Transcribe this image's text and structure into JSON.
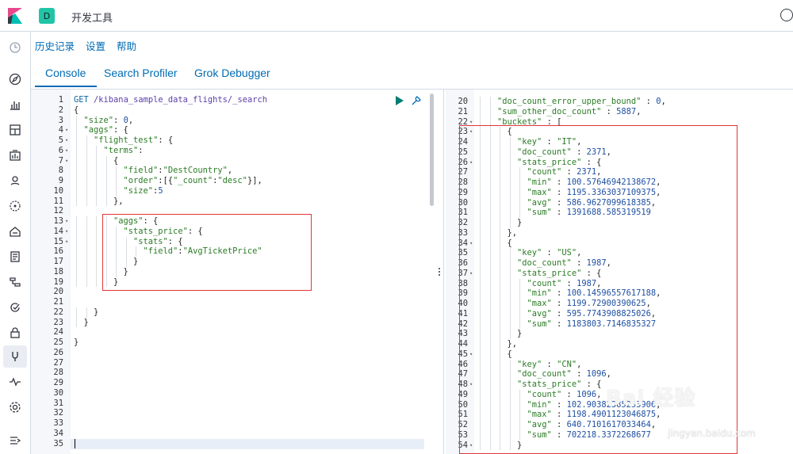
{
  "header": {
    "space_initial": "D",
    "app_title": "开发工具"
  },
  "menu": {
    "history": "历史记录",
    "settings": "设置",
    "help": "帮助"
  },
  "tabs": [
    {
      "label": "Console",
      "active": true
    },
    {
      "label": "Search Profiler",
      "active": false
    },
    {
      "label": "Grok Debugger",
      "active": false
    }
  ],
  "colors": {
    "accent": "#006bb4",
    "space_badge": "#1fc5a6",
    "highlight_box": "#e0353b",
    "run_button": "#017d73"
  },
  "sidebar_icons": [
    "clock-icon",
    "compass-icon",
    "bar-chart-icon",
    "dashboard-icon",
    "canvas-icon",
    "maps-icon",
    "ml-icon",
    "infrastructure-icon",
    "logs-icon",
    "apm-icon",
    "uptime-icon",
    "security-icon",
    "dev-tools-icon",
    "monitoring-icon",
    "management-icon",
    "collapse-icon"
  ],
  "request_editor": {
    "lines": [
      {
        "n": "1",
        "fold": false,
        "indent": 0,
        "tokens": [
          [
            "k",
            "GET "
          ],
          [
            "u",
            "/kibana_sample_data_flights/_search"
          ]
        ]
      },
      {
        "n": "2",
        "fold": false,
        "indent": 0,
        "tokens": [
          [
            "p",
            "{"
          ]
        ]
      },
      {
        "n": "3",
        "fold": false,
        "indent": 1,
        "tokens": [
          [
            "s",
            "\"size\""
          ],
          [
            "p",
            ": "
          ],
          [
            "n",
            "0"
          ],
          [
            "p",
            ","
          ]
        ]
      },
      {
        "n": "4",
        "fold": true,
        "indent": 1,
        "tokens": [
          [
            "s",
            "\"aggs\""
          ],
          [
            "p",
            ": {"
          ]
        ]
      },
      {
        "n": "5",
        "fold": true,
        "indent": 2,
        "tokens": [
          [
            "s",
            "\"flight_test\""
          ],
          [
            "p",
            ": {"
          ]
        ]
      },
      {
        "n": "6",
        "fold": true,
        "indent": 3,
        "tokens": [
          [
            "s",
            "\"terms\""
          ],
          [
            "p",
            ":"
          ]
        ]
      },
      {
        "n": "7",
        "fold": true,
        "indent": 4,
        "tokens": [
          [
            "p",
            "{"
          ]
        ]
      },
      {
        "n": "8",
        "fold": false,
        "indent": 5,
        "tokens": [
          [
            "s",
            "\"field\""
          ],
          [
            "p",
            ":"
          ],
          [
            "s",
            "\"DestCountry\""
          ],
          [
            "p",
            ","
          ]
        ]
      },
      {
        "n": "9",
        "fold": false,
        "indent": 5,
        "tokens": [
          [
            "s",
            "\"order\""
          ],
          [
            "p",
            ":[{"
          ],
          [
            "s",
            "\"_count\""
          ],
          [
            "p",
            ":"
          ],
          [
            "s",
            "\"desc\""
          ],
          [
            "p",
            "}],"
          ]
        ]
      },
      {
        "n": "10",
        "fold": false,
        "indent": 5,
        "tokens": [
          [
            "s",
            "\"size\""
          ],
          [
            "p",
            ":"
          ],
          [
            "n",
            "5"
          ]
        ]
      },
      {
        "n": "11",
        "fold": false,
        "indent": 4,
        "tokens": [
          [
            "p",
            "},"
          ]
        ]
      },
      {
        "n": "12",
        "fold": false,
        "indent": 0,
        "tokens": []
      },
      {
        "n": "13",
        "fold": true,
        "indent": 4,
        "tokens": [
          [
            "s",
            "\"aggs\""
          ],
          [
            "p",
            ": {"
          ]
        ]
      },
      {
        "n": "14",
        "fold": true,
        "indent": 5,
        "tokens": [
          [
            "s",
            "\"stats_price\""
          ],
          [
            "p",
            ": {"
          ]
        ]
      },
      {
        "n": "15",
        "fold": true,
        "indent": 6,
        "tokens": [
          [
            "s",
            "\"stats\""
          ],
          [
            "p",
            ": {"
          ]
        ]
      },
      {
        "n": "16",
        "fold": false,
        "indent": 7,
        "tokens": [
          [
            "s",
            "\"field\""
          ],
          [
            "p",
            ":"
          ],
          [
            "s",
            "\"AvgTicketPrice\""
          ]
        ]
      },
      {
        "n": "17",
        "fold": false,
        "indent": 6,
        "tokens": [
          [
            "p",
            "}"
          ]
        ]
      },
      {
        "n": "18",
        "fold": false,
        "indent": 5,
        "tokens": [
          [
            "p",
            "}"
          ]
        ]
      },
      {
        "n": "19",
        "fold": false,
        "indent": 4,
        "tokens": [
          [
            "p",
            "}"
          ]
        ]
      },
      {
        "n": "20",
        "fold": false,
        "indent": 0,
        "tokens": []
      },
      {
        "n": "21",
        "fold": false,
        "indent": 0,
        "tokens": []
      },
      {
        "n": "22",
        "fold": false,
        "indent": 2,
        "tokens": [
          [
            "p",
            "}"
          ]
        ]
      },
      {
        "n": "23",
        "fold": false,
        "indent": 1,
        "tokens": [
          [
            "p",
            "}"
          ]
        ]
      },
      {
        "n": "24",
        "fold": false,
        "indent": 0,
        "tokens": []
      },
      {
        "n": "25",
        "fold": false,
        "indent": 0,
        "tokens": [
          [
            "p",
            "}"
          ]
        ]
      },
      {
        "n": "26",
        "fold": false,
        "indent": 0,
        "tokens": []
      },
      {
        "n": "27",
        "fold": false,
        "indent": 0,
        "tokens": []
      },
      {
        "n": "28",
        "fold": false,
        "indent": 0,
        "tokens": []
      },
      {
        "n": "29",
        "fold": false,
        "indent": 0,
        "tokens": []
      },
      {
        "n": "30",
        "fold": false,
        "indent": 0,
        "tokens": []
      },
      {
        "n": "31",
        "fold": false,
        "indent": 0,
        "tokens": []
      },
      {
        "n": "32",
        "fold": false,
        "indent": 0,
        "tokens": []
      },
      {
        "n": "33",
        "fold": false,
        "indent": 0,
        "tokens": []
      },
      {
        "n": "34",
        "fold": false,
        "indent": 0,
        "tokens": []
      },
      {
        "n": "35",
        "fold": false,
        "indent": 0,
        "tokens": []
      }
    ]
  },
  "response_viewer": {
    "lines": [
      {
        "n": "20",
        "fold": false,
        "indent": 2,
        "tokens": [
          [
            "s",
            "\"doc_count_error_upper_bound\""
          ],
          [
            "p",
            " : "
          ],
          [
            "n",
            "0"
          ],
          [
            "p",
            ","
          ]
        ]
      },
      {
        "n": "21",
        "fold": false,
        "indent": 2,
        "tokens": [
          [
            "s",
            "\"sum_other_doc_count\""
          ],
          [
            "p",
            " : "
          ],
          [
            "n",
            "5887"
          ],
          [
            "p",
            ","
          ]
        ]
      },
      {
        "n": "22",
        "fold": true,
        "indent": 2,
        "tokens": [
          [
            "s",
            "\"buckets\""
          ],
          [
            "p",
            " : ["
          ]
        ]
      },
      {
        "n": "23",
        "fold": true,
        "indent": 3,
        "tokens": [
          [
            "p",
            "{"
          ]
        ]
      },
      {
        "n": "24",
        "fold": false,
        "indent": 4,
        "tokens": [
          [
            "s",
            "\"key\""
          ],
          [
            "p",
            " : "
          ],
          [
            "s",
            "\"IT\""
          ],
          [
            "p",
            ","
          ]
        ]
      },
      {
        "n": "25",
        "fold": false,
        "indent": 4,
        "tokens": [
          [
            "s",
            "\"doc_count\""
          ],
          [
            "p",
            " : "
          ],
          [
            "n",
            "2371"
          ],
          [
            "p",
            ","
          ]
        ]
      },
      {
        "n": "26",
        "fold": true,
        "indent": 4,
        "tokens": [
          [
            "s",
            "\"stats_price\""
          ],
          [
            "p",
            " : {"
          ]
        ]
      },
      {
        "n": "27",
        "fold": false,
        "indent": 5,
        "tokens": [
          [
            "s",
            "\"count\""
          ],
          [
            "p",
            " : "
          ],
          [
            "n",
            "2371"
          ],
          [
            "p",
            ","
          ]
        ]
      },
      {
        "n": "28",
        "fold": false,
        "indent": 5,
        "tokens": [
          [
            "s",
            "\"min\""
          ],
          [
            "p",
            " : "
          ],
          [
            "n",
            "100.57646942138672"
          ],
          [
            "p",
            ","
          ]
        ]
      },
      {
        "n": "29",
        "fold": false,
        "indent": 5,
        "tokens": [
          [
            "s",
            "\"max\""
          ],
          [
            "p",
            " : "
          ],
          [
            "n",
            "1195.3363037109375"
          ],
          [
            "p",
            ","
          ]
        ]
      },
      {
        "n": "30",
        "fold": false,
        "indent": 5,
        "tokens": [
          [
            "s",
            "\"avg\""
          ],
          [
            "p",
            " : "
          ],
          [
            "n",
            "586.9627099618385"
          ],
          [
            "p",
            ","
          ]
        ]
      },
      {
        "n": "31",
        "fold": false,
        "indent": 5,
        "tokens": [
          [
            "s",
            "\"sum\""
          ],
          [
            "p",
            " : "
          ],
          [
            "n",
            "1391688.585319519"
          ]
        ]
      },
      {
        "n": "32",
        "fold": false,
        "indent": 4,
        "tokens": [
          [
            "p",
            "}"
          ]
        ]
      },
      {
        "n": "33",
        "fold": false,
        "indent": 3,
        "tokens": [
          [
            "p",
            "},"
          ]
        ]
      },
      {
        "n": "34",
        "fold": true,
        "indent": 3,
        "tokens": [
          [
            "p",
            "{"
          ]
        ]
      },
      {
        "n": "35",
        "fold": false,
        "indent": 4,
        "tokens": [
          [
            "s",
            "\"key\""
          ],
          [
            "p",
            " : "
          ],
          [
            "s",
            "\"US\""
          ],
          [
            "p",
            ","
          ]
        ]
      },
      {
        "n": "36",
        "fold": false,
        "indent": 4,
        "tokens": [
          [
            "s",
            "\"doc_count\""
          ],
          [
            "p",
            " : "
          ],
          [
            "n",
            "1987"
          ],
          [
            "p",
            ","
          ]
        ]
      },
      {
        "n": "37",
        "fold": true,
        "indent": 4,
        "tokens": [
          [
            "s",
            "\"stats_price\""
          ],
          [
            "p",
            " : {"
          ]
        ]
      },
      {
        "n": "38",
        "fold": false,
        "indent": 5,
        "tokens": [
          [
            "s",
            "\"count\""
          ],
          [
            "p",
            " : "
          ],
          [
            "n",
            "1987"
          ],
          [
            "p",
            ","
          ]
        ]
      },
      {
        "n": "39",
        "fold": false,
        "indent": 5,
        "tokens": [
          [
            "s",
            "\"min\""
          ],
          [
            "p",
            " : "
          ],
          [
            "n",
            "100.14596557617188"
          ],
          [
            "p",
            ","
          ]
        ]
      },
      {
        "n": "40",
        "fold": false,
        "indent": 5,
        "tokens": [
          [
            "s",
            "\"max\""
          ],
          [
            "p",
            " : "
          ],
          [
            "n",
            "1199.72900390625"
          ],
          [
            "p",
            ","
          ]
        ]
      },
      {
        "n": "41",
        "fold": false,
        "indent": 5,
        "tokens": [
          [
            "s",
            "\"avg\""
          ],
          [
            "p",
            " : "
          ],
          [
            "n",
            "595.7743908825026"
          ],
          [
            "p",
            ","
          ]
        ]
      },
      {
        "n": "42",
        "fold": false,
        "indent": 5,
        "tokens": [
          [
            "s",
            "\"sum\""
          ],
          [
            "p",
            " : "
          ],
          [
            "n",
            "1183803.7146835327"
          ]
        ]
      },
      {
        "n": "43",
        "fold": false,
        "indent": 4,
        "tokens": [
          [
            "p",
            "}"
          ]
        ]
      },
      {
        "n": "44",
        "fold": false,
        "indent": 3,
        "tokens": [
          [
            "p",
            "},"
          ]
        ]
      },
      {
        "n": "45",
        "fold": true,
        "indent": 3,
        "tokens": [
          [
            "p",
            "{"
          ]
        ]
      },
      {
        "n": "46",
        "fold": false,
        "indent": 4,
        "tokens": [
          [
            "s",
            "\"key\""
          ],
          [
            "p",
            " : "
          ],
          [
            "s",
            "\"CN\""
          ],
          [
            "p",
            ","
          ]
        ]
      },
      {
        "n": "47",
        "fold": false,
        "indent": 4,
        "tokens": [
          [
            "s",
            "\"doc_count\""
          ],
          [
            "p",
            " : "
          ],
          [
            "n",
            "1096"
          ],
          [
            "p",
            ","
          ]
        ]
      },
      {
        "n": "48",
        "fold": true,
        "indent": 4,
        "tokens": [
          [
            "s",
            "\"stats_price\""
          ],
          [
            "p",
            " : {"
          ]
        ]
      },
      {
        "n": "49",
        "fold": false,
        "indent": 5,
        "tokens": [
          [
            "s",
            "\"count\""
          ],
          [
            "p",
            " : "
          ],
          [
            "n",
            "1096"
          ],
          [
            "p",
            ","
          ]
        ]
      },
      {
        "n": "50",
        "fold": false,
        "indent": 5,
        "tokens": [
          [
            "s",
            "\"min\""
          ],
          [
            "p",
            " : "
          ],
          [
            "n",
            "102.90382385253906"
          ],
          [
            "p",
            ","
          ]
        ]
      },
      {
        "n": "51",
        "fold": false,
        "indent": 5,
        "tokens": [
          [
            "s",
            "\"max\""
          ],
          [
            "p",
            " : "
          ],
          [
            "n",
            "1198.4901123046875"
          ],
          [
            "p",
            ","
          ]
        ]
      },
      {
        "n": "52",
        "fold": false,
        "indent": 5,
        "tokens": [
          [
            "s",
            "\"avg\""
          ],
          [
            "p",
            " : "
          ],
          [
            "n",
            "640.7101617033464"
          ],
          [
            "p",
            ","
          ]
        ]
      },
      {
        "n": "53",
        "fold": false,
        "indent": 5,
        "tokens": [
          [
            "s",
            "\"sum\""
          ],
          [
            "p",
            " : "
          ],
          [
            "n",
            "702218.3372268677"
          ]
        ]
      },
      {
        "n": "54",
        "fold": true,
        "indent": 4,
        "tokens": [
          [
            "p",
            "}"
          ]
        ]
      }
    ]
  },
  "watermark": {
    "brand": "Bai 经验",
    "url": "jingyan.baidu.com"
  }
}
